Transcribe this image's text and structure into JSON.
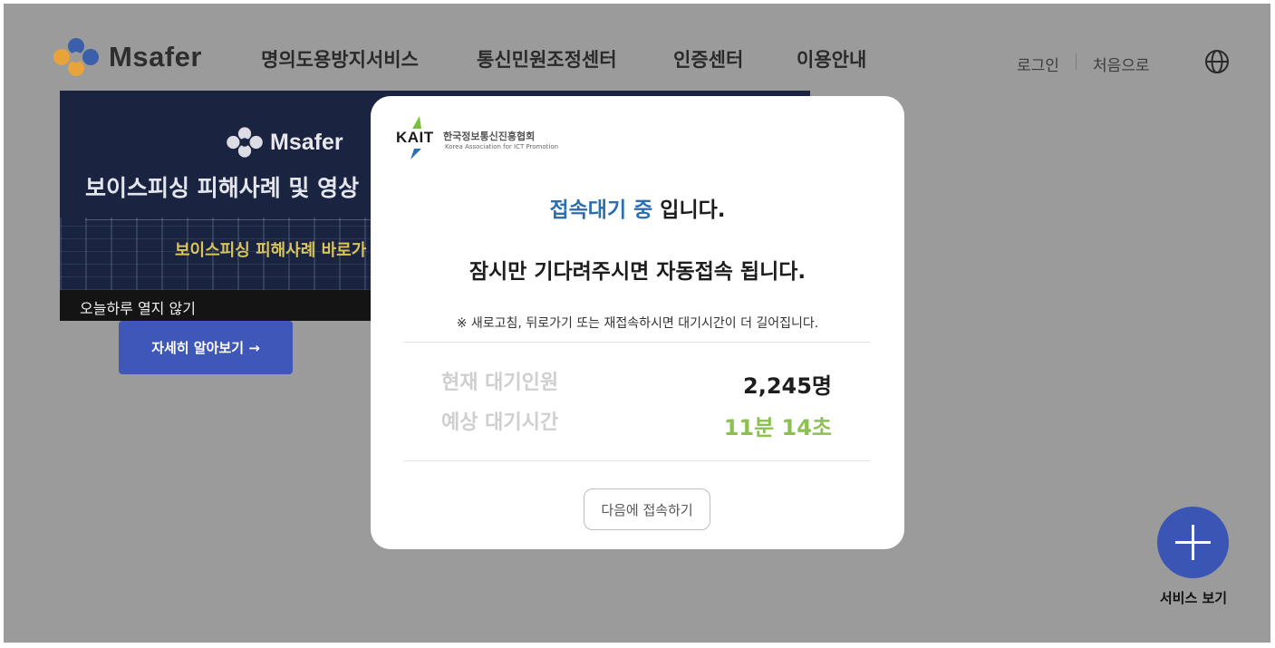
{
  "header": {
    "logo_text": "Msafer",
    "nav": [
      "명의도용방지서비스",
      "통신민원조정센터",
      "인증센터",
      "이용안내"
    ],
    "login": "로그인",
    "home": "처음으로",
    "globe_icon": "globe-icon"
  },
  "banner": {
    "logo_text": "Msafer",
    "title": "보이스피싱 피해사례 및 영상",
    "subtitle": "보이스피싱 피해사례 바로가",
    "close_today": "오늘하루 열지 않기",
    "more_button": "자세히 알아보기 →"
  },
  "fab": {
    "label": "서비스 보기",
    "icon": "plus-icon"
  },
  "modal": {
    "org_abbr": "KAIT",
    "org_name_kr": "한국정보통신진흥협회",
    "org_name_en": "Korea Association for ICT Promotion",
    "title_highlight": "접속대기 중",
    "title_rest": " 입니다.",
    "subtitle": "잠시만 기다려주시면 자동접속 됩니다.",
    "note": "※ 새로고침, 뒤로가기 또는 재접속하시면 대기시간이 더 길어집니다.",
    "queue_label": "현재 대기인원",
    "queue_value": "2,245명",
    "wait_label": "예상 대기시간",
    "wait_value": "11분 14초",
    "later_button": "다음에 접속하기",
    "colors": {
      "highlight": "#2c6fb1",
      "wait_time": "#8cc152"
    }
  }
}
